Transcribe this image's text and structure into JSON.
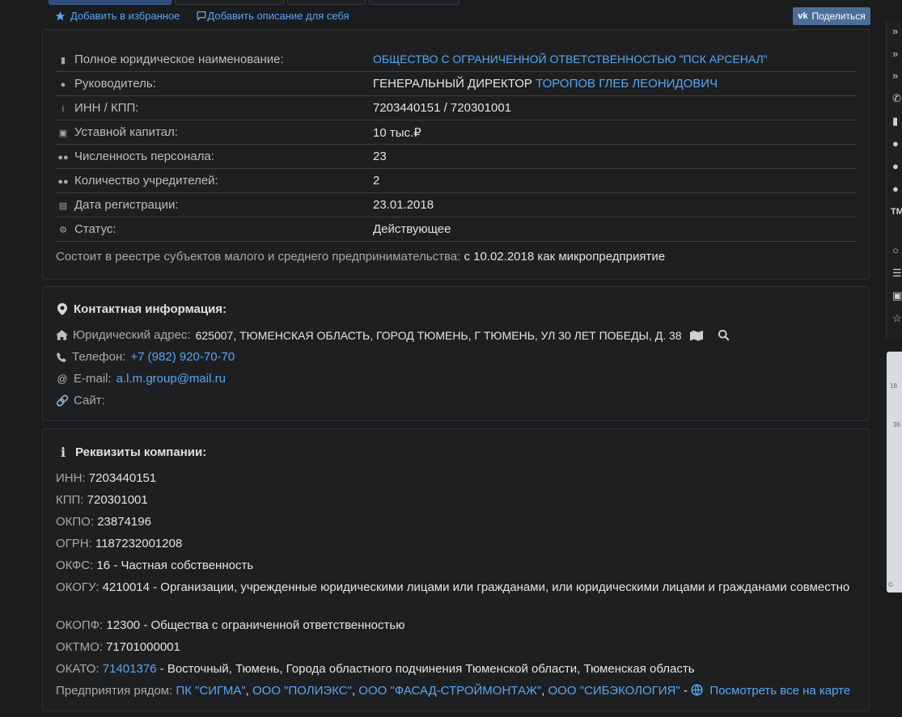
{
  "toplinks": {
    "favorite": "Добавить в избранное",
    "description": "Добавить описание для себя",
    "share": "Поделиться"
  },
  "info": {
    "fullname_label": "Полное юридическое наименование:",
    "fullname_value": "ОБЩЕСТВО С ОГРАНИЧЕННОЙ ОТВЕТСТВЕННОСТЬЮ \"ПСК АРСЕНАЛ\"",
    "director_label": "Руководитель:",
    "director_position": "ГЕНЕРАЛЬНЫЙ ДИРЕКТОР",
    "director_name": "ТОРОПОВ ГЛЕБ ЛЕОНИДОВИЧ",
    "inn_kpp_label": "ИНН / КПП:",
    "inn_kpp_value": "7203440151 / 720301001",
    "capital_label": "Уставной капитал:",
    "capital_value": "10 тыс.₽",
    "staff_label": "Численность персонала:",
    "staff_value": "23",
    "founders_label": "Количество учредителей:",
    "founders_value": "2",
    "regdate_label": "Дата регистрации:",
    "regdate_value": "23.01.2018",
    "status_label": "Статус:",
    "status_value": "Действующее",
    "smsp_label": "Состоит в реестре субъектов малого и среднего предпринимательства:",
    "smsp_value": "с 10.02.2018 как микропредприятие"
  },
  "contacts": {
    "title": "Контактная информация:",
    "address_label": "Юридический адрес:",
    "address_value": "625007, ТЮМЕНСКАЯ ОБЛАСТЬ, ГОРОД ТЮМЕНЬ, Г ТЮМЕНЬ, УЛ 30 ЛЕТ ПОБЕДЫ, Д. 38",
    "phone_label": "Телефон:",
    "phone_value": "+7 (982) 920-70-70",
    "email_label": "E-mail:",
    "email_value": "a.l.m.group@mail.ru",
    "site_label": "Сайт:"
  },
  "requisites": {
    "title": "Реквизиты компании:",
    "inn_label": "ИНН:",
    "inn_value": "7203440151",
    "kpp_label": "КПП:",
    "kpp_value": "720301001",
    "okpo_label": "ОКПО:",
    "okpo_value": "23874196",
    "ogrn_label": "ОГРН:",
    "ogrn_value": "1187232001208",
    "okfs_label": "ОКФС:",
    "okfs_value": "16 - Частная собственность",
    "okogu_label": "ОКОГУ:",
    "okogu_value": "4210014 - Организации, учрежденные юридическими лицами или гражданами, или юридическими лицами и гражданами совместно",
    "okopf_label": "ОКОПФ:",
    "okopf_value": "12300 - Общества с ограниченной ответственностью",
    "oktmo_label": "ОКТМО:",
    "oktmo_value": "71701000001",
    "okato_label": "ОКАТО:",
    "okato_code": "71401376",
    "okato_desc": "- Восточный, Тюмень, Города областного подчинения Тюменской области, Тюменская область",
    "nearby_label": "Предприятия рядом:",
    "nearby": [
      "ПК \"СИГМА\"",
      "ООО \"ПОЛИЭКС\"",
      "ООО \"ФАСАД-СТРОЙМОНТАЖ\"",
      "ООО \"СИБЭКОЛОГИЯ\""
    ],
    "nearby_map": "Посмотреть все на карте"
  },
  "sidebar": {
    "tm_label": "TM"
  },
  "map": {
    "labels": [
      "18",
      "36",
      "©"
    ]
  },
  "colors": {
    "link": "#5aa6f5",
    "background": "#1b1c1e",
    "panel": "#1e1f21",
    "share_button": "#4c6f98"
  }
}
